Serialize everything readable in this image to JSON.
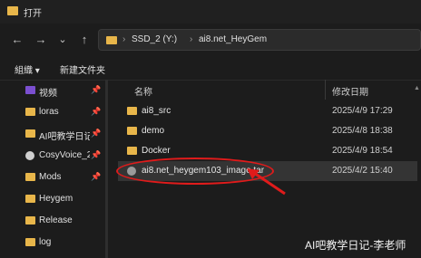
{
  "window": {
    "title": "打开"
  },
  "nav": {
    "back": "←",
    "forward": "→",
    "dropdown": "⌄",
    "up": "↑"
  },
  "address": {
    "crumb1": "SSD_2 (Y:)",
    "crumb2": "ai8.net_HeyGem",
    "separator": "›"
  },
  "toolbar": {
    "organize": "組織 ▾",
    "new_folder": "新建文件夹"
  },
  "sidebar": {
    "items": [
      {
        "label": "视频",
        "pinned": true
      },
      {
        "label": "loras",
        "pinned": true
      },
      {
        "label": "AI吧教学日记",
        "pinned": true
      },
      {
        "label": "CosyVoice_2",
        "pinned": true
      },
      {
        "label": "Mods",
        "pinned": true
      },
      {
        "label": "Heygem",
        "pinned": false
      },
      {
        "label": "Release",
        "pinned": false
      },
      {
        "label": "log",
        "pinned": false
      }
    ],
    "pin_glyph": "📌"
  },
  "columns": {
    "name": "名称",
    "modified": "修改日期"
  },
  "files": [
    {
      "name": "ai8_src",
      "date": "2025/4/9 17:29",
      "type": "folder"
    },
    {
      "name": "demo",
      "date": "2025/4/8 18:38",
      "type": "folder"
    },
    {
      "name": "Docker",
      "date": "2025/4/9 18:54",
      "type": "folder"
    },
    {
      "name": "ai8.net_heygem103_image.tar",
      "date": "2025/4/2 15:40",
      "type": "tar"
    }
  ],
  "annotation": {
    "highlight_color": "#e01b1b"
  },
  "watermark": "AI吧教学日记-李老师"
}
